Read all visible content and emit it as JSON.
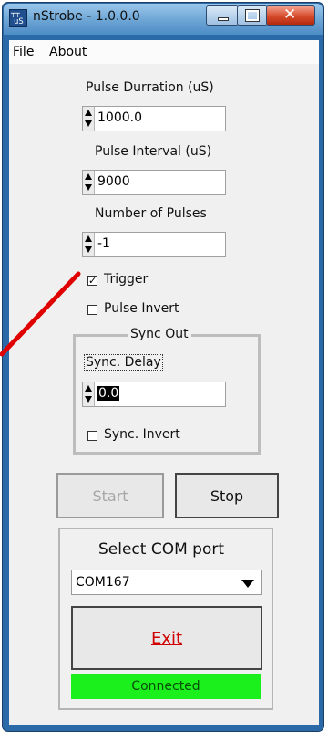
{
  "window": {
    "title": "nStrobe - 1.0.0.0",
    "app_icon_text": "uS"
  },
  "menu": {
    "items": [
      "File",
      "About"
    ]
  },
  "pulse_duration": {
    "label": "Pulse Durration (uS)",
    "value": "1000.0"
  },
  "pulse_interval": {
    "label": "Pulse Interval (uS)",
    "value": "9000"
  },
  "num_pulses": {
    "label": "Number of Pulses",
    "value": "-1"
  },
  "trigger": {
    "label": "Trigger",
    "checked": true
  },
  "pulse_invert": {
    "label": "Pulse Invert",
    "checked": false
  },
  "sync_out": {
    "group_label": "Sync Out",
    "delay_label": "Sync. Delay",
    "delay_value": "0.0",
    "invert_label": "Sync. Invert",
    "invert_checked": false
  },
  "buttons": {
    "start": "Start",
    "stop": "Stop",
    "exit": "Exit"
  },
  "com": {
    "group_label": "Select COM port",
    "selected": "COM167"
  },
  "status": {
    "text": "Connected",
    "color": "#1cf01c"
  },
  "colors": {
    "annotation_arrow": "#e00000",
    "exit_text": "#d00000"
  }
}
